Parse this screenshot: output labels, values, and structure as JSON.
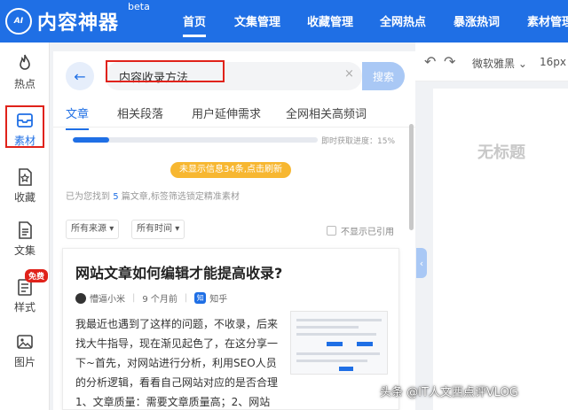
{
  "app": {
    "logo_mark": "AI",
    "logo_text": "内容神器",
    "logo_beta": "beta"
  },
  "nav": [
    {
      "label": "首页",
      "active": true
    },
    {
      "label": "文集管理"
    },
    {
      "label": "收藏管理"
    },
    {
      "label": "全网热点"
    },
    {
      "label": "暴涨热词"
    },
    {
      "label": "素材管理"
    }
  ],
  "sidebar": [
    {
      "label": "热点",
      "icon": "flame-icon"
    },
    {
      "label": "素材",
      "icon": "inbox-icon",
      "active": true
    },
    {
      "label": "收藏",
      "icon": "star-doc-icon"
    },
    {
      "label": "文集",
      "icon": "document-icon"
    },
    {
      "label": "样式",
      "icon": "style-icon",
      "badge": "免费"
    },
    {
      "label": "图片",
      "icon": "image-icon"
    }
  ],
  "search": {
    "value": "内容收录方法",
    "button": "搜索",
    "clear": "×"
  },
  "tabs": [
    "文章",
    "相关段落",
    "用户延伸需求",
    "全网相关高频词"
  ],
  "progress": {
    "label": "即时获取进度：15%",
    "percent": 15
  },
  "notice": "未显示信息34条,点击刷新",
  "summary": {
    "prefix": "已为您找到",
    "count": "5",
    "suffix": "篇文章,标签筛选锁定精准素材"
  },
  "filters": {
    "source": "所有来源",
    "time": "所有时间",
    "hide_used": "不显示已引用"
  },
  "article": {
    "title": "网站文章如何编辑才能提高收录?",
    "author": "懵逼小米",
    "time": "9 个月前",
    "platform_mark": "知",
    "platform": "知乎",
    "body": "我最近也遇到了这样的问题，不收录，后来找大牛指导，现在渐见起色了，在这分享一下~首先，对网站进行分析，利用SEO人员的分析逻辑，看看自己网站对应的是否合理1、文章质量：需要文章质量高；2、网站"
  },
  "editor": {
    "font": "微软雅黑",
    "size": "16px",
    "doc_title": "无标题"
  },
  "watermark": "头条 @IT人文西点评VLOG",
  "colors": {
    "brand": "#1f6fe5",
    "highlight_box": "#e0221a",
    "notice": "#f7b731"
  }
}
